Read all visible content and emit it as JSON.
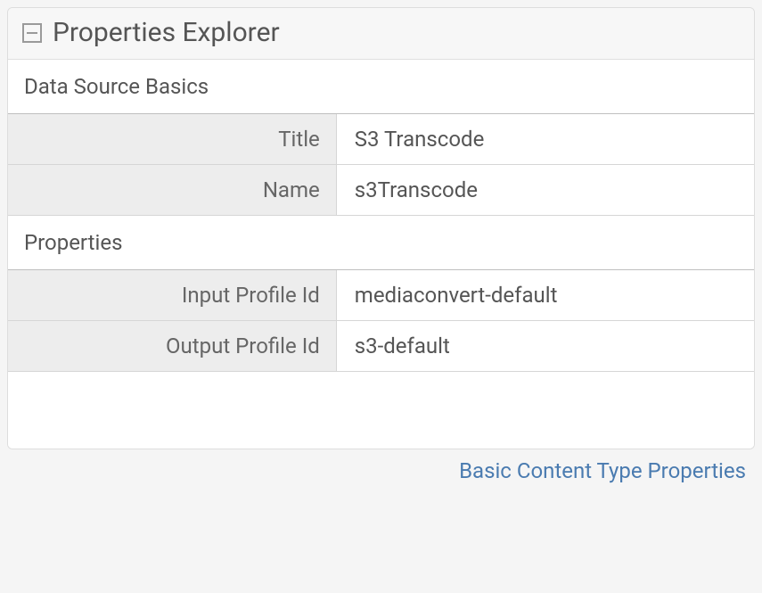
{
  "panel": {
    "title": "Properties Explorer"
  },
  "sections": {
    "basics": {
      "heading": "Data Source Basics",
      "rows": {
        "title": {
          "label": "Title",
          "value": "S3 Transcode"
        },
        "name": {
          "label": "Name",
          "value": "s3Transcode"
        }
      }
    },
    "properties": {
      "heading": "Properties",
      "rows": {
        "inputProfileId": {
          "label": "Input Profile Id",
          "value": "mediaconvert-default"
        },
        "outputProfileId": {
          "label": "Output Profile Id",
          "value": "s3-default"
        }
      }
    }
  },
  "footer": {
    "link": "Basic Content Type Properties"
  }
}
